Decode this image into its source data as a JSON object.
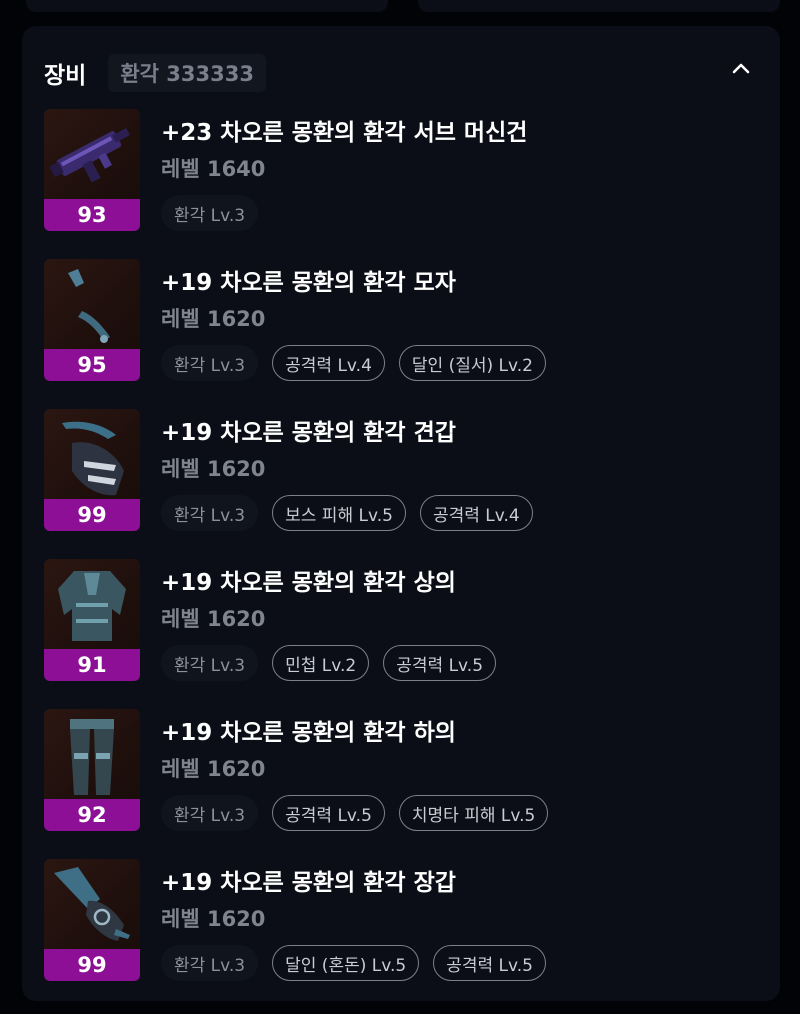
{
  "header": {
    "title": "장비",
    "subtitle": "환각 333333"
  },
  "items": [
    {
      "name": "+23 차오른 몽환의 환각 서브 머신건",
      "level": "레벨 1640",
      "score": "93",
      "tags": [
        {
          "label": "환각 Lv.3",
          "style": "plain"
        }
      ]
    },
    {
      "name": "+19 차오른 몽환의 환각 모자",
      "level": "레벨 1620",
      "score": "95",
      "tags": [
        {
          "label": "환각 Lv.3",
          "style": "plain"
        },
        {
          "label": "공격력 Lv.4",
          "style": "outline"
        },
        {
          "label": "달인 (질서) Lv.2",
          "style": "outline"
        }
      ]
    },
    {
      "name": "+19 차오른 몽환의 환각 견갑",
      "level": "레벨 1620",
      "score": "99",
      "tags": [
        {
          "label": "환각 Lv.3",
          "style": "plain"
        },
        {
          "label": "보스 피해 Lv.5",
          "style": "outline"
        },
        {
          "label": "공격력 Lv.4",
          "style": "outline"
        }
      ]
    },
    {
      "name": "+19 차오른 몽환의 환각 상의",
      "level": "레벨 1620",
      "score": "91",
      "tags": [
        {
          "label": "환각 Lv.3",
          "style": "plain"
        },
        {
          "label": "민첩 Lv.2",
          "style": "outline"
        },
        {
          "label": "공격력 Lv.5",
          "style": "outline"
        }
      ]
    },
    {
      "name": "+19 차오른 몽환의 환각 하의",
      "level": "레벨 1620",
      "score": "92",
      "tags": [
        {
          "label": "환각 Lv.3",
          "style": "plain"
        },
        {
          "label": "공격력 Lv.5",
          "style": "outline"
        },
        {
          "label": "치명타 피해 Lv.5",
          "style": "outline"
        }
      ]
    },
    {
      "name": "+19 차오른 몽환의 환각 장갑",
      "level": "레벨 1620",
      "score": "99",
      "tags": [
        {
          "label": "환각 Lv.3",
          "style": "plain"
        },
        {
          "label": "달인 (혼돈) Lv.5",
          "style": "outline"
        },
        {
          "label": "공격력 Lv.5",
          "style": "outline"
        }
      ]
    }
  ],
  "icons": [
    "submachine-gun-icon",
    "hat-icon",
    "pauldron-icon",
    "top-armor-icon",
    "pants-icon",
    "gloves-icon"
  ],
  "colors": {
    "score_badge": "#8c0f96",
    "panel": "#0b0e16",
    "background": "#020307"
  }
}
